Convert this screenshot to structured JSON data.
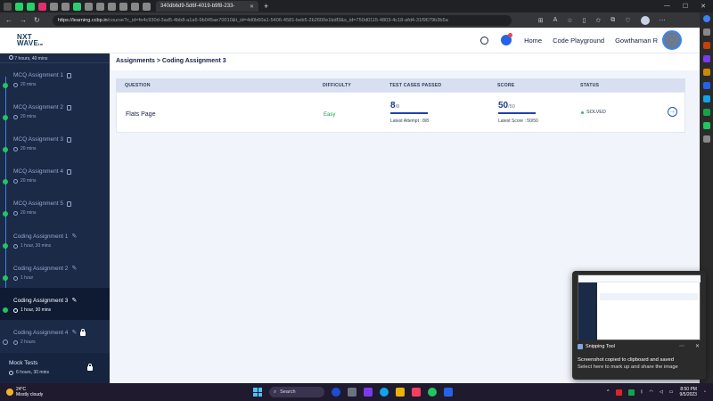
{
  "browser": {
    "active_tab_title": "340db6d9-5d6f-4019-b9f8-233-",
    "url_host": "https://learning.ccbp.in",
    "url_path": "/course?c_id=fe4c930d-3ad5-4bb8-a1a5-9b045ae70010&t_id=4d0b60a1-5406-4581-beb5-2b2600e1bdf3&s_id=750d0115-4803-4c18-afd4-31f9679b3b5a"
  },
  "header": {
    "logo_line1": "NXT",
    "logo_line2": "WAVE",
    "logo_sub": "tm",
    "home": "Home",
    "code_playground": "Code Playground",
    "user_name": "Gowthaman R"
  },
  "sidebar": {
    "top_duration": "7 hours, 40 mins",
    "items": [
      {
        "label": "MCQ Assignment 1",
        "duration": "20 mins"
      },
      {
        "label": "MCQ Assignment 2",
        "duration": "20 mins"
      },
      {
        "label": "MCQ Assignment 3",
        "duration": "20 mins"
      },
      {
        "label": "MCQ Assignment 4",
        "duration": "20 mins"
      },
      {
        "label": "MCQ Assignment 5",
        "duration": "20 mins"
      },
      {
        "label": "Coding Assignment 1",
        "duration": "1 hour, 30 mins"
      },
      {
        "label": "Coding Assignment 2",
        "duration": "1 hour"
      },
      {
        "label": "Coding Assignment 3",
        "duration": "1 hour, 30 mins"
      },
      {
        "label": "Coding Assignment 4",
        "duration": "2 hours"
      }
    ],
    "mock": {
      "label": "Mock Tests",
      "duration": "6 hours, 30 mins"
    }
  },
  "main": {
    "breadcrumb": "Assignments > Coding Assignment 3",
    "columns": [
      "QUESTION",
      "DIFFICULTY",
      "TEST CASES PASSED",
      "SCORE",
      "STATUS"
    ],
    "row": {
      "question": "Flats Page",
      "difficulty": "Easy",
      "tests_passed": "8",
      "tests_total": "/8",
      "latest_attempt": "Latest Attempt : 8/8",
      "score": "50",
      "score_total": "/50",
      "latest_score": "Latest Score : 50/50",
      "status": "SOLVED"
    }
  },
  "toast": {
    "app_name": "Snipping Tool",
    "message": "Screenshot copied to clipboard and saved",
    "sub_message": "Select here to mark up and share the image"
  },
  "taskbar": {
    "temp": "24°C",
    "weather": "Mostly cloudy",
    "search_placeholder": "Search",
    "time": "8:50 PM",
    "date": "9/5/2023"
  },
  "colors": {
    "sidebar_bg": "#1b2a47",
    "accent": "#1e40af",
    "success": "#22c55e"
  }
}
